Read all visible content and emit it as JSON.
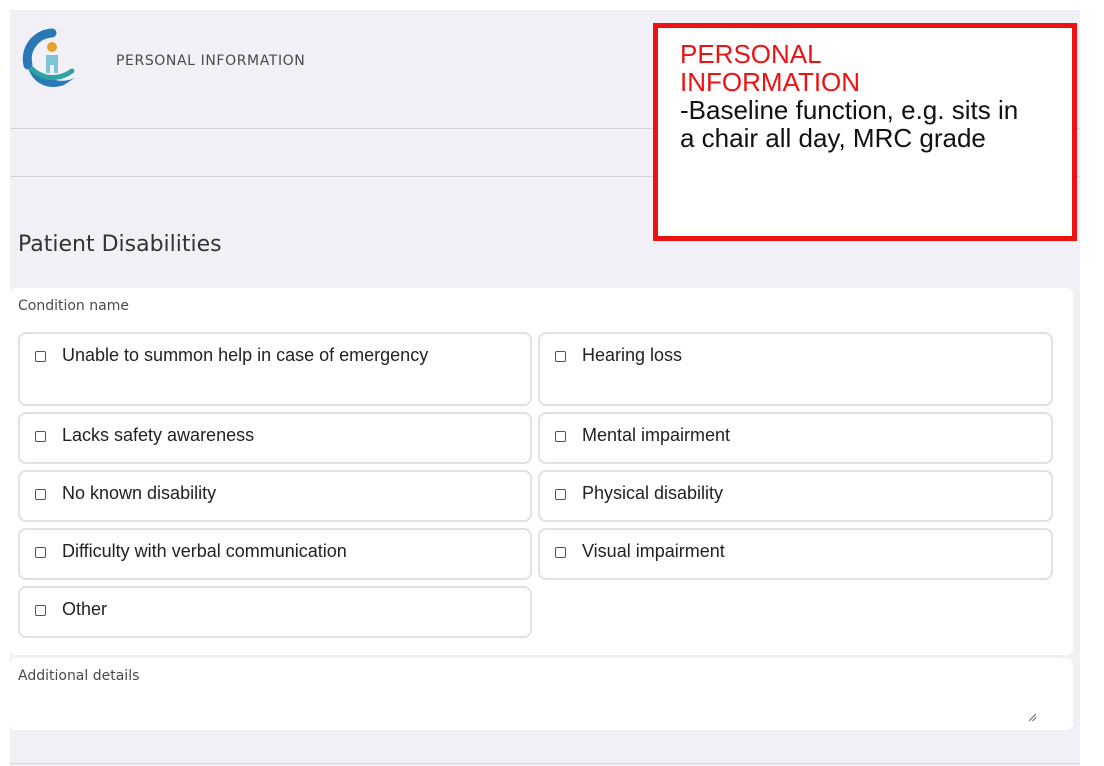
{
  "header": {
    "title": "PERSONAL INFORMATION",
    "logo_icon": "person-in-hand-icon"
  },
  "section": {
    "title": "Patient Disabilities"
  },
  "condition": {
    "label": "Condition name",
    "options": [
      {
        "label": "Unable to summon help in case of emergency",
        "checked": false
      },
      {
        "label": "Hearing loss",
        "checked": false
      },
      {
        "label": "Lacks safety awareness",
        "checked": false
      },
      {
        "label": "Mental impairment",
        "checked": false
      },
      {
        "label": "No known disability",
        "checked": false
      },
      {
        "label": "Physical disability",
        "checked": false
      },
      {
        "label": "Difficulty with verbal communication",
        "checked": false
      },
      {
        "label": "Visual impairment",
        "checked": false
      },
      {
        "label": "Other",
        "checked": false
      }
    ]
  },
  "additional": {
    "label": "Additional details",
    "value": ""
  },
  "callout": {
    "title": "PERSONAL INFORMATION",
    "body": "-Baseline function, e.g. sits in a chair all day, MRC grade"
  },
  "colors": {
    "accent_red": "#ee1111",
    "logo_blue": "#2a78b5",
    "logo_teal": "#2fa3a3",
    "logo_gold": "#e2a42a",
    "background": "#f1f0f6"
  }
}
